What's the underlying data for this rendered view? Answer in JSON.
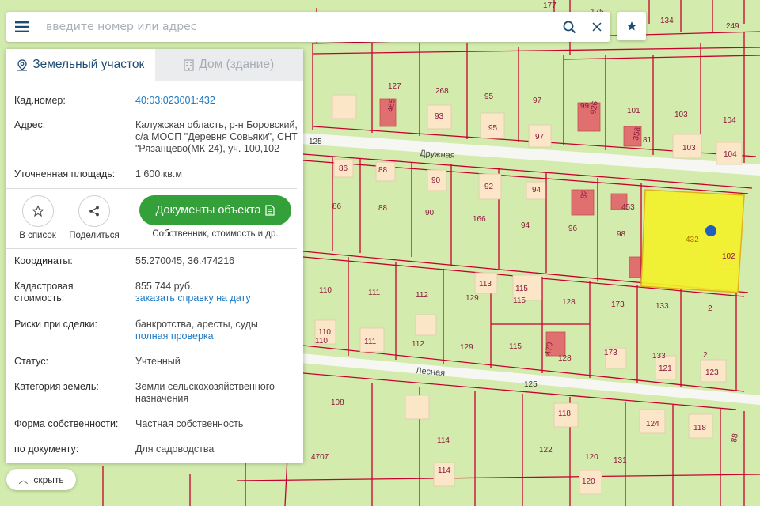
{
  "search": {
    "placeholder": "введите номер или адрес"
  },
  "panel": {
    "tab_land": "Земельный участок",
    "tab_building": "Дом (здание)",
    "cad_number_label": "Кад.номер:",
    "cad_number": "40:03:023001:432",
    "address_label": "Адрес:",
    "address_line1": "Калужская область, р-н Боровский,",
    "address_line2": "с/а МОСП \"Деревня Совьяки\", СНТ",
    "address_line3": "\"Рязанцево(МК-24), уч. 100,102",
    "area_label": "Уточненная площадь:",
    "area": "1 600 кв.м",
    "to_list": "В список",
    "share": "Поделиться",
    "docs_button": "Документы объекта",
    "docs_sub": "Собственник, стоимость и др.",
    "coords_label": "Координаты:",
    "coords": "55.270045, 36.474216",
    "cad_value_label1": "Кадастровая",
    "cad_value_label2": "стоимость:",
    "cad_value": "855 744 руб.",
    "cad_value_link": "заказать справку на дату",
    "risks_label": "Риски при сделки:",
    "risks": "банкротства, аресты, суды",
    "risks_link": "полная проверка",
    "status_label": "Статус:",
    "status": "Учтенный",
    "category_label": "Категория земель:",
    "category_line1": "Земли сельскохозяйственного",
    "category_line2": "назначения",
    "ownership_label": "Форма собственности:",
    "ownership": "Частная собственность",
    "by_doc_label": "по документу:",
    "by_doc": "Для садоводства"
  },
  "hide_button": "скрыть",
  "map": {
    "street_druzhnaya": "Дружная",
    "street_lesnaya": "Лесная",
    "road_125": "125",
    "selected_parcel": "432",
    "parcel_labels": [
      "127",
      "268",
      "95",
      "97",
      "99",
      "101",
      "103",
      "104",
      "93",
      "95",
      "97",
      "103",
      "104",
      "465",
      "926",
      "358",
      "81",
      "86",
      "88",
      "90",
      "92",
      "94",
      "82",
      "453",
      "86",
      "88",
      "90",
      "166",
      "94",
      "96",
      "98",
      "102",
      "110",
      "111",
      "112",
      "129",
      "113",
      "115",
      "115",
      "128",
      "173",
      "133",
      "2",
      "110",
      "110",
      "111",
      "112",
      "129",
      "115",
      "470",
      "128",
      "173",
      "133",
      "2",
      "121",
      "123",
      "108",
      "114",
      "118",
      "122",
      "124",
      "118",
      "120",
      "131",
      "4707",
      "114",
      "120",
      "134",
      "249",
      "177",
      "175",
      "88"
    ]
  },
  "colors": {
    "selected_fill": "#f2f02a",
    "parcel_line": "#c8002e",
    "map_bg": "#d3ecae",
    "docs_green": "#34a03a",
    "link_blue": "#1d79c4"
  }
}
